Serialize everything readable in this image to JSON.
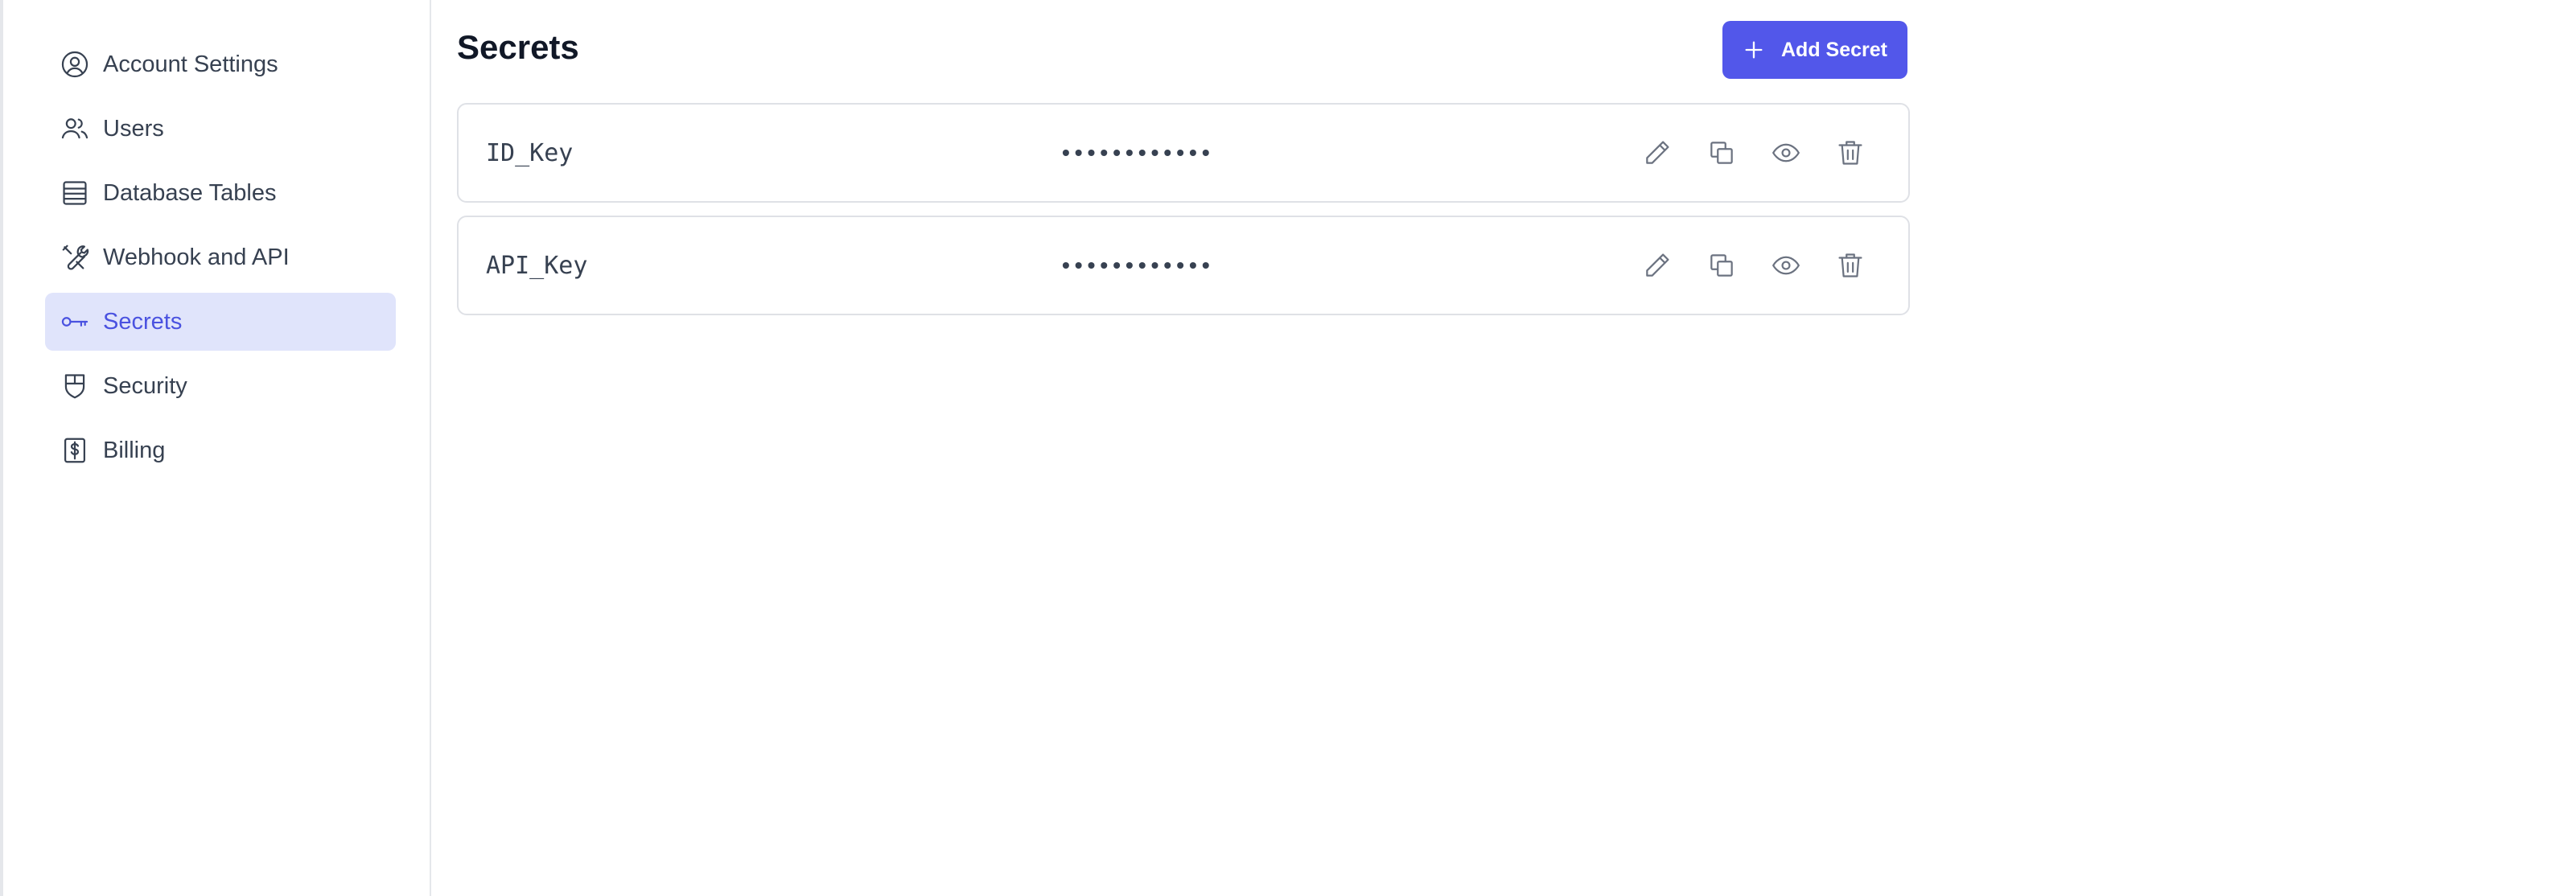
{
  "sidebar": {
    "items": [
      {
        "label": "Account Settings",
        "icon": "user-circle-icon",
        "active": false
      },
      {
        "label": "Users",
        "icon": "users-icon",
        "active": false
      },
      {
        "label": "Database Tables",
        "icon": "table-icon",
        "active": false
      },
      {
        "label": "Webhook and API",
        "icon": "wrench-screwdriver-icon",
        "active": false
      },
      {
        "label": "Secrets",
        "icon": "key-icon",
        "active": true
      },
      {
        "label": "Security",
        "icon": "shield-icon",
        "active": false
      },
      {
        "label": "Billing",
        "icon": "dollar-icon",
        "active": false
      }
    ]
  },
  "main": {
    "title": "Secrets",
    "add_button": {
      "label": "Add Secret",
      "icon": "plus-icon"
    },
    "secrets": [
      {
        "name": "ID_Key",
        "masked_value": "••••••••••••"
      },
      {
        "name": "API_Key",
        "masked_value": "••••••••••••"
      }
    ],
    "row_actions": [
      "pencil-icon",
      "copy-icon",
      "eye-icon",
      "trash-icon"
    ]
  },
  "colors": {
    "accent": "#5257ea",
    "active_bg": "#e0e4fb",
    "active_text": "#4a52e0",
    "border": "#dfe1e6"
  }
}
